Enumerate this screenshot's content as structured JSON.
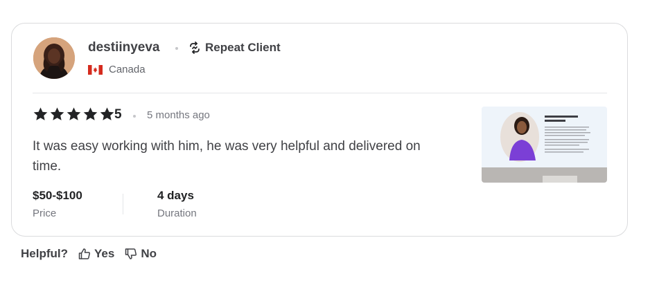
{
  "reviewer": {
    "username": "destiinyeva",
    "badge": "Repeat Client",
    "badge_icon": "repeat-icon",
    "country": "Canada",
    "country_flag": "canada-flag-icon"
  },
  "review": {
    "stars": 5,
    "rating": "5",
    "time_ago": "5 months ago",
    "text": "It was easy working with him, he was very helpful and delivered on time.",
    "price_value": "$50-$100",
    "price_label": "Price",
    "duration_value": "4 days",
    "duration_label": "Duration"
  },
  "feedback": {
    "question": "Helpful?",
    "yes_label": "Yes",
    "no_label": "No"
  },
  "colors": {
    "text_primary": "#404145",
    "text_muted": "#74767e",
    "star": "#222325",
    "border": "#dadbdd"
  }
}
